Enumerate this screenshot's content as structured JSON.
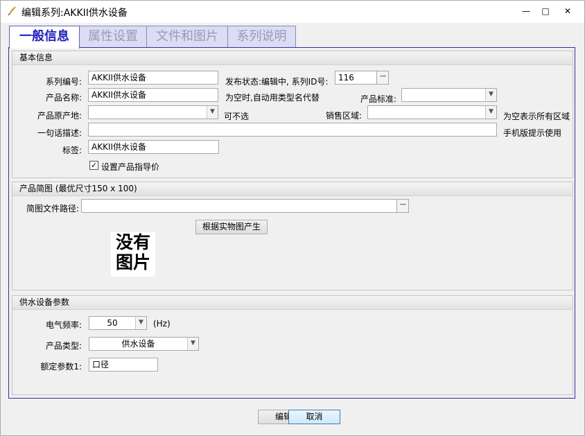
{
  "window": {
    "title": "编辑系列:AKKII供水设备",
    "minimize_glyph": "—",
    "maximize_glyph": "□",
    "close_glyph": "✕"
  },
  "tabs": [
    {
      "label": "一般信息"
    },
    {
      "label": "属性设置"
    },
    {
      "label": "文件和图片"
    },
    {
      "label": "系列说明"
    }
  ],
  "basic_info": {
    "header": "基本信息",
    "series_no_label": "系列编号:",
    "series_no_value": "AKKII供水设备",
    "publish_status": "发布状态:编辑中, 系列ID号:",
    "series_id_value": "116",
    "product_name_label": "产品名称:",
    "product_name_value": "AKKII供水设备",
    "empty_hint": "为空时,自动用类型名代替",
    "standard_label": "产品标准:",
    "standard_value": "",
    "origin_label": "产品原产地:",
    "origin_value": "",
    "optional_hint": "可不选",
    "sales_region_label": "销售区域:",
    "sales_region_value": "",
    "all_region_hint": "为空表示所有区域",
    "one_line_label": "一句话描述:",
    "one_line_value": "",
    "mobile_hint": "手机版提示使用",
    "tag_label": "标签:",
    "tag_value": "AKKII供水设备",
    "guide_price_label": "设置产品指导价",
    "guide_price_checked": true
  },
  "thumbnail": {
    "header": "产品简图 (最优尺寸150 x 100)",
    "path_label": "简图文件路径:",
    "path_value": "",
    "generate_button": "根据实物图产生",
    "no_image_line1": "没有",
    "no_image_line2": "图片"
  },
  "params": {
    "header": "供水设备参数",
    "freq_label": "电气频率:",
    "freq_value": "50",
    "freq_unit": "(Hz)",
    "type_label": "产品类型:",
    "type_value": "供水设备",
    "rated_label": "额定参数1:",
    "rated_value": "口径"
  },
  "footer": {
    "edit_button": "编辑",
    "cancel_button": "取消"
  }
}
